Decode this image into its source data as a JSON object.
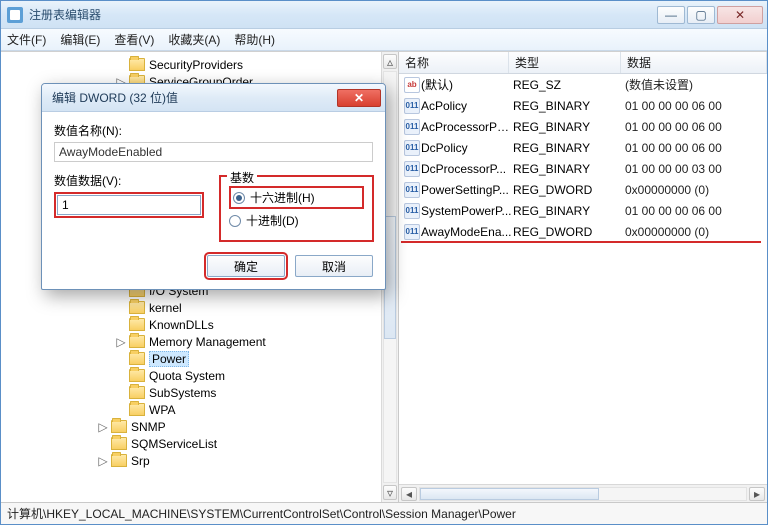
{
  "window": {
    "title": "注册表编辑器",
    "minimize_glyph": "—",
    "maximize_glyph": "▢",
    "close_glyph": "✕"
  },
  "menubar": {
    "file": "文件(F)",
    "edit": "编辑(E)",
    "view": "查看(V)",
    "fav": "收藏夹(A)",
    "help": "帮助(H)"
  },
  "tree": [
    {
      "indent": 6,
      "expand": "",
      "label": "SecurityProviders"
    },
    {
      "indent": 6,
      "expand": "▷",
      "label": "ServiceGroupOrder"
    },
    {
      "indent": 6,
      "expand": "",
      "label": "I/O System"
    },
    {
      "indent": 6,
      "expand": "",
      "label": "kernel"
    },
    {
      "indent": 6,
      "expand": "",
      "label": "KnownDLLs"
    },
    {
      "indent": 6,
      "expand": "▷",
      "label": "Memory Management"
    },
    {
      "indent": 6,
      "expand": "",
      "label": "Power",
      "selected": true
    },
    {
      "indent": 6,
      "expand": "",
      "label": "Quota System"
    },
    {
      "indent": 6,
      "expand": "",
      "label": "SubSystems"
    },
    {
      "indent": 6,
      "expand": "",
      "label": "WPA"
    },
    {
      "indent": 5,
      "expand": "▷",
      "label": "SNMP"
    },
    {
      "indent": 5,
      "expand": "",
      "label": "SQMServiceList"
    },
    {
      "indent": 5,
      "expand": "▷",
      "label": "Srp"
    }
  ],
  "list": {
    "headers": {
      "name": "名称",
      "type": "类型",
      "data": "数据"
    },
    "rows": [
      {
        "icon": "str",
        "name": "(默认)",
        "type": "REG_SZ",
        "data": "(数值未设置)"
      },
      {
        "icon": "bin",
        "name": "AcPolicy",
        "type": "REG_BINARY",
        "data": "01 00 00 00 06 00"
      },
      {
        "icon": "bin",
        "name": "AcProcessorPo...",
        "type": "REG_BINARY",
        "data": "01 00 00 00 06 00"
      },
      {
        "icon": "bin",
        "name": "DcPolicy",
        "type": "REG_BINARY",
        "data": "01 00 00 00 06 00"
      },
      {
        "icon": "bin",
        "name": "DcProcessorP...",
        "type": "REG_BINARY",
        "data": "01 00 00 00 03 00"
      },
      {
        "icon": "bin",
        "name": "PowerSettingP...",
        "type": "REG_DWORD",
        "data": "0x00000000 (0)"
      },
      {
        "icon": "bin",
        "name": "SystemPowerP...",
        "type": "REG_BINARY",
        "data": "01 00 00 00 06 00"
      },
      {
        "icon": "bin",
        "name": "AwayModeEna...",
        "type": "REG_DWORD",
        "data": "0x00000000 (0)",
        "highlight": true
      }
    ]
  },
  "dialog": {
    "title": "编辑 DWORD (32 位)值",
    "name_label": "数值名称(N):",
    "name_value": "AwayModeEnabled",
    "data_label": "数值数据(V):",
    "data_value": "1",
    "radix_legend": "基数",
    "radix_hex": "十六进制(H)",
    "radix_dec": "十进制(D)",
    "ok": "确定",
    "cancel": "取消",
    "close_glyph": "✕"
  },
  "statusbar": {
    "path": "计算机\\HKEY_LOCAL_MACHINE\\SYSTEM\\CurrentControlSet\\Control\\Session Manager\\Power"
  },
  "glyphs": {
    "tri_right": "▷",
    "tri_left": "◁",
    "tri_up": "▵",
    "tri_down": "▿",
    "arrow_l": "◂",
    "arrow_r": "▸"
  }
}
